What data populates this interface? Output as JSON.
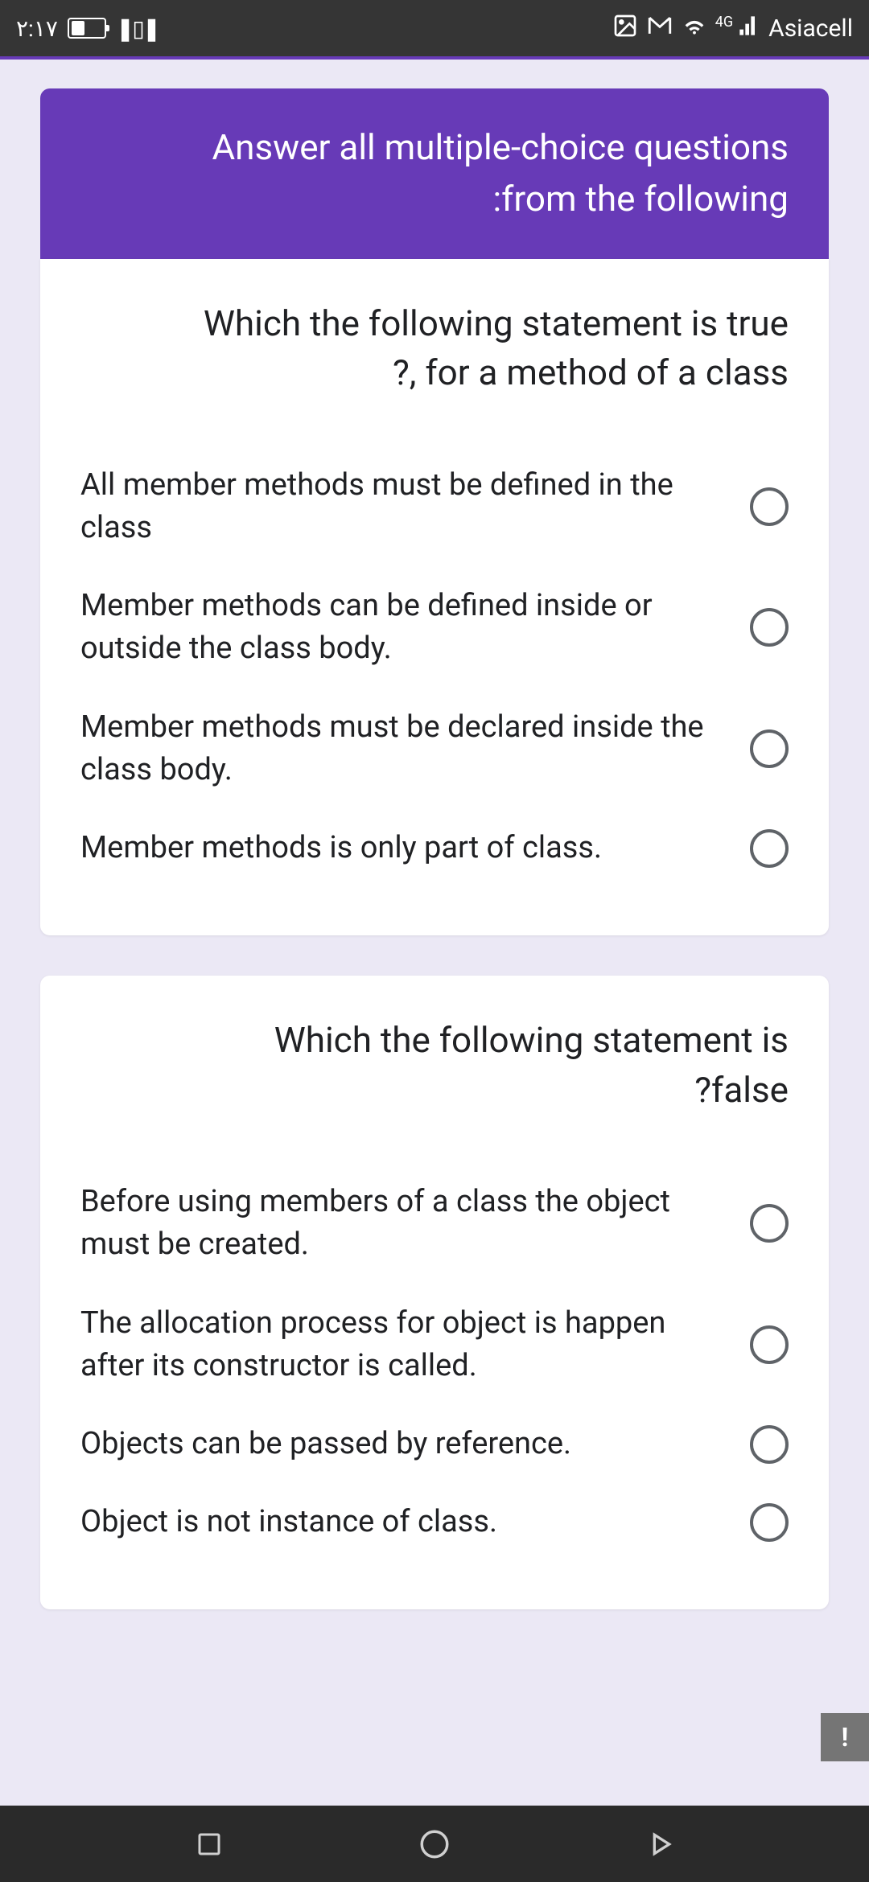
{
  "status_bar": {
    "time": "٢:١٧",
    "carrier": "Asiacell",
    "network": "4G"
  },
  "header": {
    "title_line1": "Answer all multiple-choice questions",
    "title_line2": ":from the following"
  },
  "questions": [
    {
      "text_line1": "Which the following statement is true",
      "text_line2": "?, for a method of a class",
      "options": [
        "All member methods must be defined in the class",
        "Member methods can be defined inside or outside the class body.",
        "Member methods must be declared inside the class body.",
        "Member methods is only part of class."
      ]
    },
    {
      "text_line1": "Which the following statement is",
      "text_line2": "?false",
      "options": [
        "Before using members of a class the object must be created.",
        "The allocation process for object is happen after its constructor is called.",
        "Objects can be passed by reference.",
        "Object is not instance of class."
      ]
    }
  ],
  "feedback": {
    "label": "!"
  }
}
